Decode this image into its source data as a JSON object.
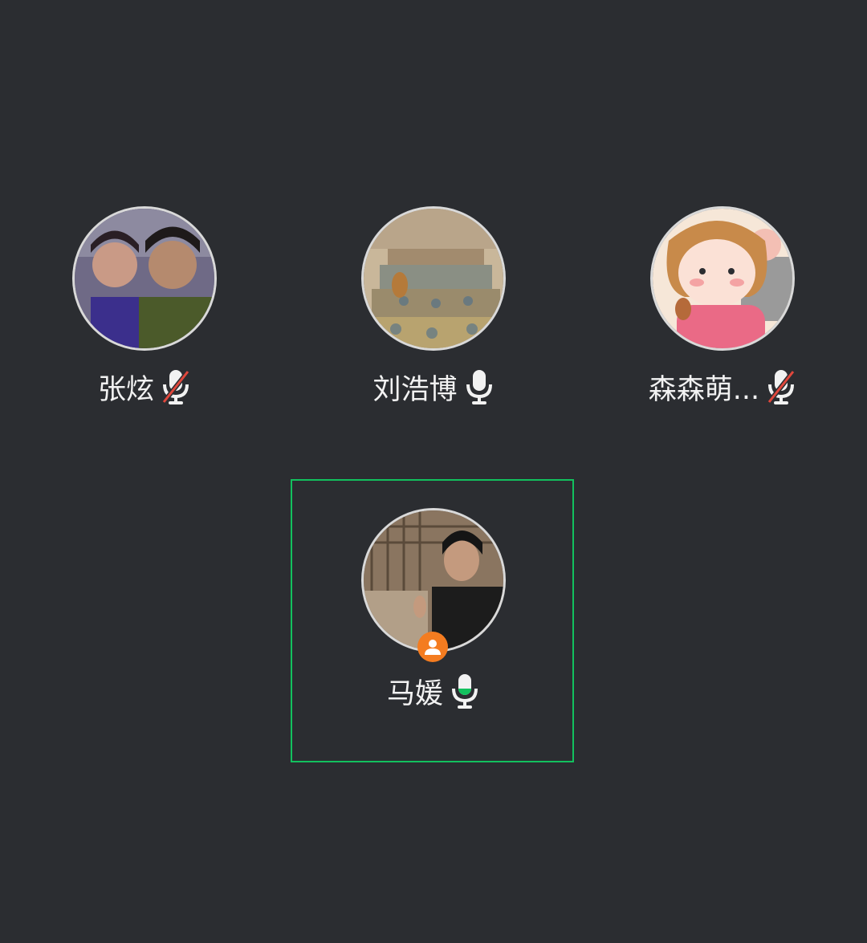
{
  "participants": [
    {
      "name": "张炫",
      "mic": "muted",
      "avatar_icon": "photo-couple-icon"
    },
    {
      "name": "刘浩博",
      "mic": "on",
      "avatar_icon": "photo-stairs-cat-icon"
    },
    {
      "name": "森森萌...",
      "mic": "muted",
      "avatar_icon": "cartoon-girl-icon"
    },
    {
      "name": "马媛",
      "mic": "speaking",
      "avatar_icon": "photo-woman-icon",
      "role_badge": "host-badge-icon",
      "active_speaker": true
    }
  ],
  "colors": {
    "background": "#2b2d31",
    "active_speaker_border": "#12c15e",
    "muted_slash": "#e0473c",
    "host_badge": "#f47c20",
    "speaking_mic_fill": "#12c15e"
  }
}
